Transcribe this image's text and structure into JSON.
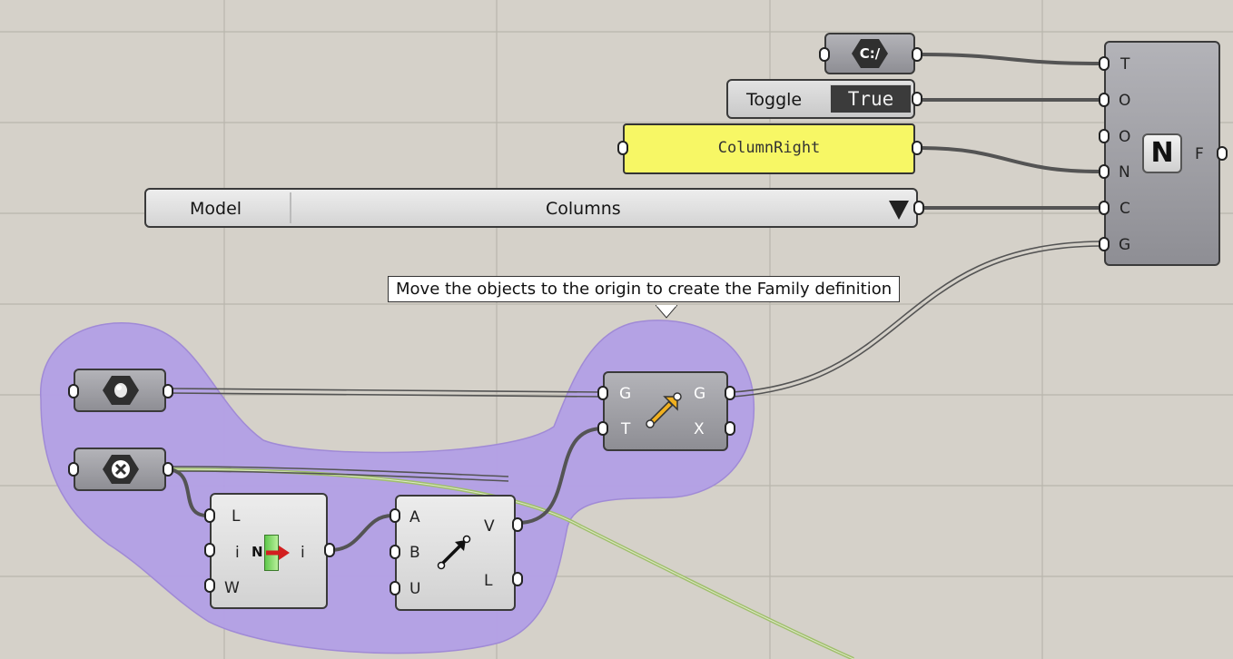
{
  "canvas": {
    "background": "#d5d1c9",
    "group_color": "#b29fe6",
    "wire_color": "#555555",
    "selected_wire_color": "#9fbf6b"
  },
  "file_path_component": {
    "icon": "file-path-icon",
    "icon_text": "C:/"
  },
  "toggle": {
    "label": "Toggle",
    "value": "True"
  },
  "panel": {
    "text": "ColumnRight",
    "color": "#f7f765"
  },
  "value_list": {
    "label": "Model",
    "selected": "Columns"
  },
  "family_component": {
    "icon": "family-n-icon",
    "icon_text": "N",
    "inputs": [
      "T",
      "O",
      "O",
      "N",
      "C",
      "G"
    ],
    "output": "F"
  },
  "tooltip": {
    "text": "Move the objects to the origin to create the Family definition"
  },
  "geometry_param": {
    "icon": "geometry-icon"
  },
  "delete_param": {
    "icon": "delete-x-icon"
  },
  "move_component": {
    "icon": "move-arrow-icon",
    "inputs": [
      "G",
      "T"
    ],
    "outputs": [
      "G",
      "X"
    ]
  },
  "list_item_component": {
    "icon": "list-item-icon",
    "icon_text": "N",
    "inputs": [
      "L",
      "i",
      "W"
    ],
    "output": "i"
  },
  "vector_component": {
    "icon": "vector-2pt-icon",
    "inputs": [
      "A",
      "B",
      "U"
    ],
    "outputs": [
      "V",
      "L"
    ]
  }
}
